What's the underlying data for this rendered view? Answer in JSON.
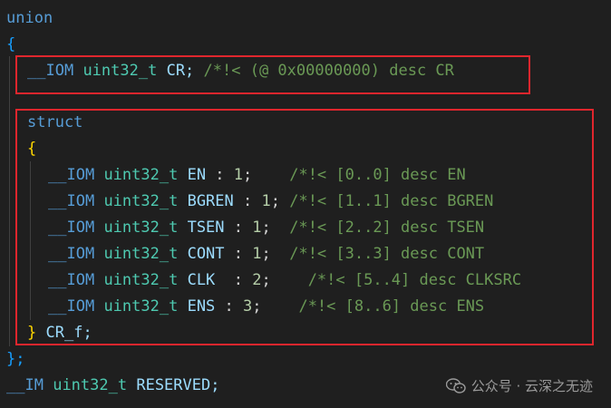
{
  "code": {
    "union_kw": "union",
    "open_brace": "{",
    "cr_line": {
      "macro": "__IOM",
      "type": "uint32_t",
      "name": "CR;",
      "comment": "/*!< (@ 0x00000000) desc CR"
    },
    "struct_kw": "struct",
    "struct_open": "{",
    "fields": [
      {
        "macro": "__IOM",
        "type": "uint32_t",
        "name": "EN",
        "sep": " : ",
        "width": "1",
        "end": ";    ",
        "comment": "/*!< [0..0] desc EN"
      },
      {
        "macro": "__IOM",
        "type": "uint32_t",
        "name": "BGREN",
        "sep": " : ",
        "width": "1",
        "end": "; ",
        "comment": "/*!< [1..1] desc BGREN"
      },
      {
        "macro": "__IOM",
        "type": "uint32_t",
        "name": "TSEN",
        "sep": " : ",
        "width": "1",
        "end": ";  ",
        "comment": "/*!< [2..2] desc TSEN"
      },
      {
        "macro": "__IOM",
        "type": "uint32_t",
        "name": "CONT",
        "sep": " : ",
        "width": "1",
        "end": ";  ",
        "comment": "/*!< [3..3] desc CONT"
      },
      {
        "macro": "__IOM",
        "type": "uint32_t",
        "name": "CLK",
        "sep": "  : ",
        "width": "2",
        "end": ";    ",
        "comment": "/*!< [5..4] desc CLKSRC"
      },
      {
        "macro": "__IOM",
        "type": "uint32_t",
        "name": "ENS",
        "sep": " : ",
        "width": "3",
        "end": ";    ",
        "comment": "/*!< [8..6] desc ENS"
      }
    ],
    "struct_close": "}",
    "struct_name": "CR_f;",
    "close_brace": "};",
    "reserved_line": {
      "macro": "__IM",
      "type": "uint32_t",
      "name": "RESERVED;"
    }
  },
  "watermark": {
    "text": "公众号 · 云深之无迹",
    "icon": "wechat-icon"
  },
  "colors": {
    "background": "#1f1f1f",
    "highlight_box": "#e0262d",
    "keyword": "#569cd6",
    "type": "#4ec9b0",
    "comment": "#6a9955",
    "number": "#b5cea8"
  }
}
